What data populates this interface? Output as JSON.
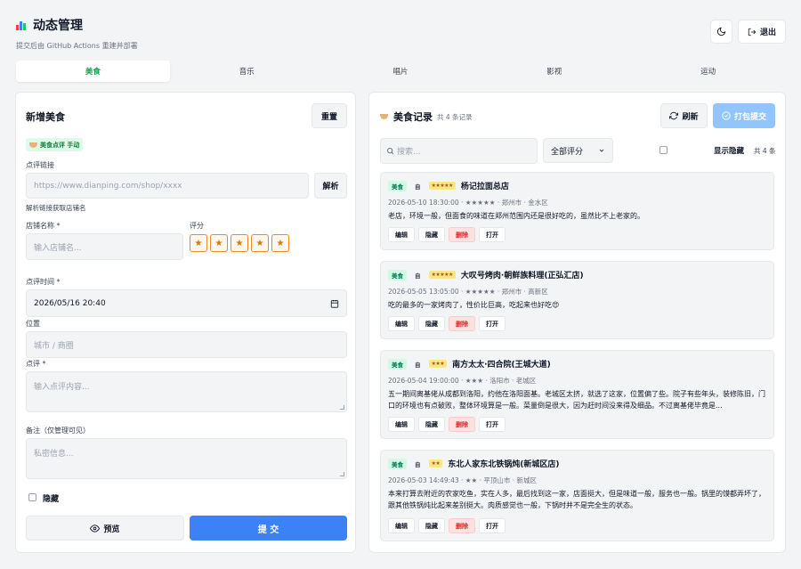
{
  "header": {
    "title": "动态管理",
    "subtitle": "提交后由 GitHub Actions 重建并部署",
    "logout_label": "退出"
  },
  "colors": {
    "accent": "#3b82f6",
    "green": "#16a34a",
    "danger": "#dc2626",
    "star": "#d97706"
  },
  "tabs": [
    {
      "label": "美食",
      "active": true
    },
    {
      "label": "音乐",
      "active": false
    },
    {
      "label": "唱片",
      "active": false
    },
    {
      "label": "影视",
      "active": false
    },
    {
      "label": "运动",
      "active": false
    }
  ],
  "form": {
    "title": "新增美食",
    "reset_label": "重置",
    "source_badge": "美食点评 手动",
    "link_label": "点评链接",
    "link_placeholder": "https://www.dianping.com/shop/xxxx",
    "parse_label": "解析",
    "parse_hint": "解析链接获取店铺名",
    "shop_label": "店铺名称 *",
    "shop_placeholder": "输入店铺名...",
    "rating_label": "评分",
    "rating_value": 5,
    "rating_max": 5,
    "time_label": "点评时间 *",
    "time_value": "2026/05/16  20:40",
    "location_label": "位置",
    "location_placeholder": "城市 / 商圈",
    "review_label": "点评 *",
    "review_placeholder": "输入点评内容...",
    "note_label": "备注（仅管理可见）",
    "note_placeholder": "私密信息...",
    "hide_label": "隐藏",
    "preview_label": "预览",
    "submit_label": "提 交"
  },
  "list": {
    "title": "美食记录",
    "count_text": "共 4 条记录",
    "refresh_label": "刷新",
    "pack_submit_label": "打包提交",
    "search_placeholder": "搜索...",
    "filter_value": "全部评分",
    "show_hidden_label": "显示隐藏",
    "total_text": "共 4 条",
    "actions": {
      "edit": "编辑",
      "hide": "隐藏",
      "delete": "删除",
      "open": "打开"
    },
    "records": [
      {
        "category": "美食",
        "source": "自",
        "rating": 5,
        "stars": "★★★★★",
        "name": "杨记拉面总店",
        "meta": "2026-05-10 18:30:00 · ★★★★★ · 郑州市 · 金水区",
        "text": "老店，环境一般，但面食的味道在郑州范围内还是很好吃的，虽然比不上老家的。"
      },
      {
        "category": "美食",
        "source": "自",
        "rating": 5,
        "stars": "★★★★★",
        "name": "大叹号烤肉·朝鲜族料理(正弘汇店)",
        "meta": "2026-05-05 13:05:00 · ★★★★★ · 郑州市 · 高新区",
        "text": "吃的最多的一家烤肉了，性价比巨高，吃起来也好吃😍"
      },
      {
        "category": "美食",
        "source": "自",
        "rating": 3,
        "stars": "★★★",
        "name": "南方太太·四合院(王城大道)",
        "meta": "2026-05-04 19:00:00 · ★★★ · 洛阳市 · 老城区",
        "text": "五一期间离基佬从成都到洛阳，约他在洛阳面基。老城区太挤，就选了这家，位置偏了些。院子有些年头，装修陈旧，门口的环境也有点破败，整体环境算是一般。菜量倒是很大，因为赶时间没来得及细品。不过离基佬毕竟是..."
      },
      {
        "category": "美食",
        "source": "自",
        "rating": 2,
        "stars": "★★",
        "name": "东北人家东北铁锅炖(新城区店)",
        "meta": "2026-05-03 14:49:43 · ★★ · 平顶山市 · 新城区",
        "text": "本来打算去附近的农家吃鱼，实在人多，最后找到这一家，店面挺大，但是味道一般，服务也一般。锅里的馍都弄坏了，跟其他铁锅炖比起来差别挺大。肉质感觉也一般，下锅时并不是完全生的状态。"
      }
    ]
  }
}
